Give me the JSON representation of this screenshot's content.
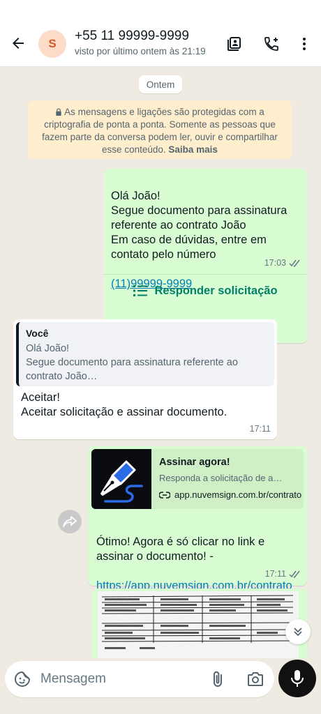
{
  "header": {
    "avatar_initial": "S",
    "contact_name": "+55 11 99999-9999",
    "status": "visto por último ontem às 21:19"
  },
  "chat": {
    "day_label": "Ontem",
    "encryption_notice": "As mensagens e ligações são protegidas com a criptografia de ponta a ponta. Somente as pessoas que fazem parte da conversa podem ler, ouvir e compartilhar esse conteúdo.",
    "encryption_link": "Saiba mais",
    "messages": [
      {
        "text": "Olá João!\nSegue documento para assinatura referente ao contrato João\nEm caso de dúvidas, entre em contato pelo número",
        "phone_link": "(11)99999-9999",
        "time": "17:03",
        "action_label": "Responder solicitação"
      },
      {
        "quote_author": "Você",
        "quote_text": "Olá João!\nSegue documento para assinatura referente ao contrato João…",
        "text": "Aceitar!\nAceitar solicitação e assinar documento.",
        "time": "17:11"
      },
      {
        "preview_title": "Assinar agora!",
        "preview_desc": "Responda a solicitação de a…",
        "preview_url": "app.nuvemsign.com.br/contrato",
        "text": "Ótimo! Agora é só clicar no link e assinar o documento! -",
        "link": "https://app.nuvemsign.com.br/contrato",
        "time": "17:11"
      }
    ]
  },
  "input": {
    "placeholder": "Mensagem"
  },
  "colors": {
    "outgoing_bubble": "#d9fdd3",
    "incoming_bubble": "#ffffff",
    "accent": "#008069",
    "link": "#027eb5",
    "chat_bg": "#efeae2",
    "notice_bg": "#ffeecd"
  },
  "icons": [
    "back-arrow-icon",
    "contact-card-icon",
    "add-call-icon",
    "more-vert-icon",
    "lock-icon",
    "double-check-icon",
    "list-icon",
    "forward-icon",
    "chevrons-down-icon",
    "sticker-icon",
    "attach-icon",
    "camera-icon",
    "mic-icon",
    "link-icon"
  ]
}
